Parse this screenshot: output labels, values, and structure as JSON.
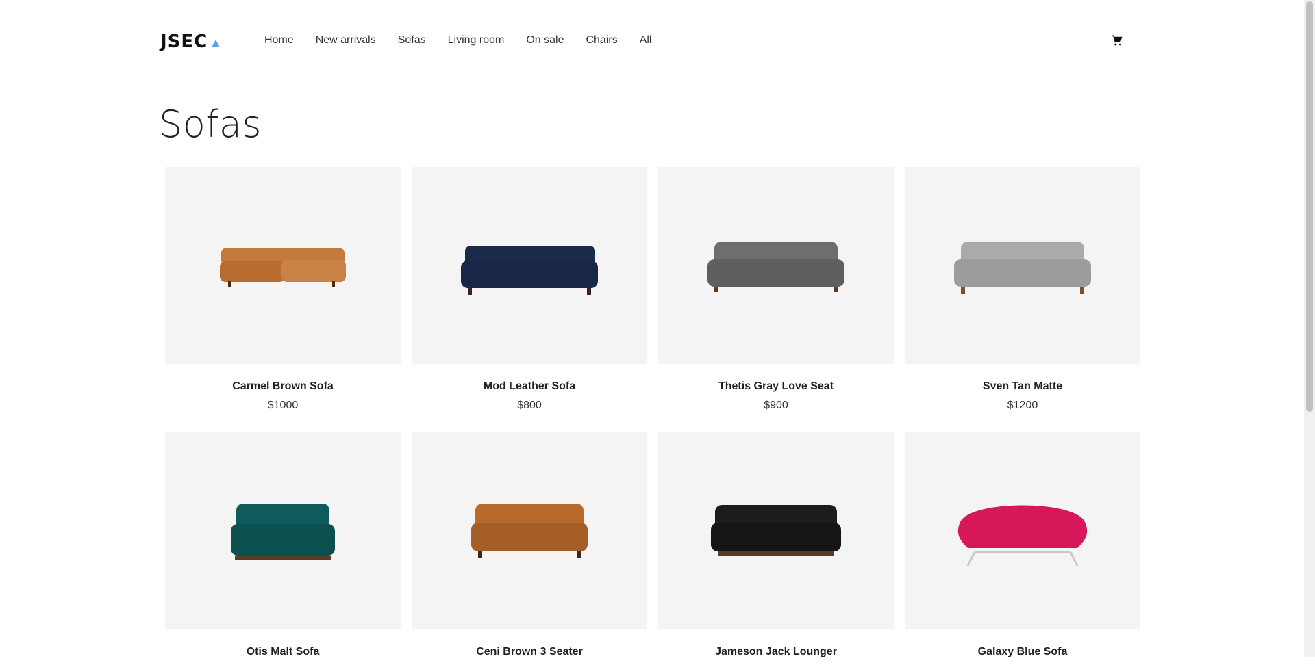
{
  "brand": {
    "logo_text": "JSEC",
    "accent_color": "#5aa0e8"
  },
  "nav": {
    "items": [
      {
        "label": "Home"
      },
      {
        "label": "New arrivals"
      },
      {
        "label": "Sofas"
      },
      {
        "label": "Living room"
      },
      {
        "label": "On sale"
      },
      {
        "label": "Chairs"
      },
      {
        "label": "All"
      }
    ],
    "cart_icon": "cart-icon"
  },
  "page": {
    "title": "Sofas"
  },
  "products": [
    {
      "name": "Carmel Brown Sofa",
      "price": "$1000",
      "color": "#c47a3c"
    },
    {
      "name": "Mod Leather Sofa",
      "price": "$800",
      "color": "#1b2a4a"
    },
    {
      "name": "Thetis Gray Love Seat",
      "price": "$900",
      "color": "#6e6e6e"
    },
    {
      "name": "Sven Tan Matte",
      "price": "$1200",
      "color": "#a9aaa9"
    },
    {
      "name": "Otis Malt Sofa",
      "price": "",
      "color": "#0f5a5a"
    },
    {
      "name": "Ceni Brown 3 Seater",
      "price": "",
      "color": "#b86a2c"
    },
    {
      "name": "Jameson Jack Lounger",
      "price": "",
      "color": "#1c1c1c"
    },
    {
      "name": "Galaxy Blue Sofa",
      "price": "",
      "color": "#d6175a"
    }
  ]
}
